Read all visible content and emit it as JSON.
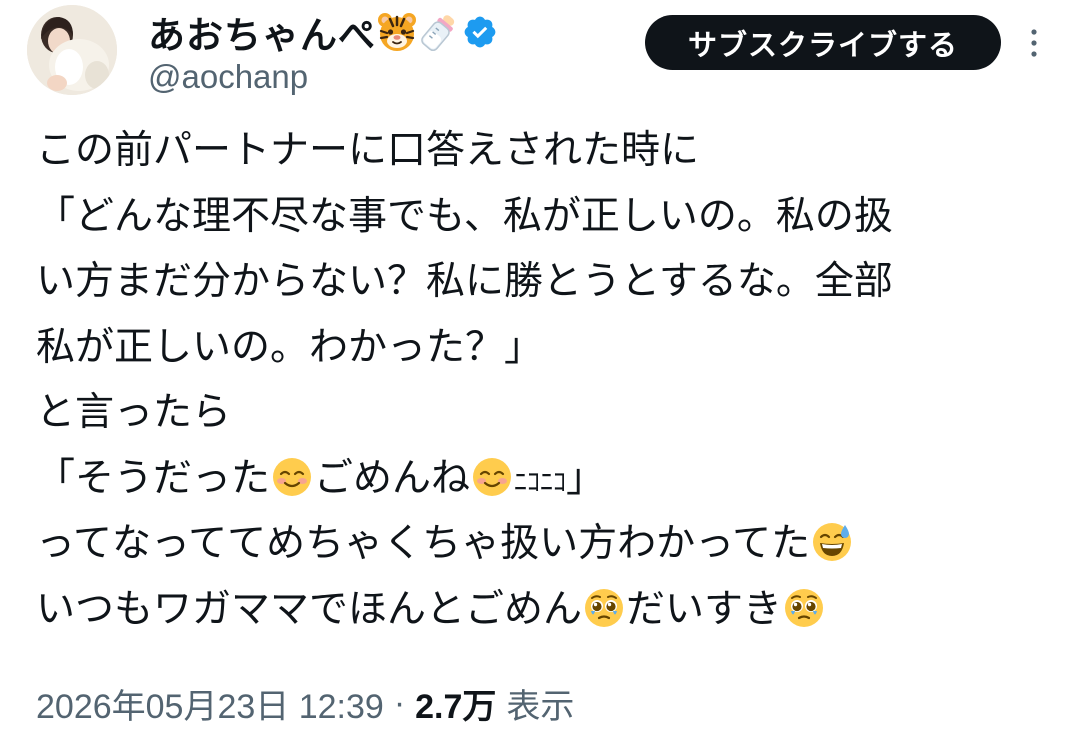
{
  "author": {
    "display_name": "あおちゃんぺ",
    "name_emojis": [
      "tiger-face-icon",
      "baby-bottle-icon"
    ],
    "verified": true,
    "handle": "@aochanp"
  },
  "actions": {
    "subscribe_label": "サブスクライブする",
    "more_icon": "more-vertical-icon"
  },
  "tweet": {
    "lines": [
      {
        "segments": [
          {
            "t": "この前パートナーに口答えされた時に"
          }
        ]
      },
      {
        "segments": [
          {
            "t": "「どんな理不尽な事でも、私が正しいの。私の扱"
          }
        ]
      },
      {
        "segments": [
          {
            "t": "い方まだ分からない？私に勝とうとするな。全部"
          }
        ]
      },
      {
        "segments": [
          {
            "t": "私が正しいの。わかった？」"
          }
        ]
      },
      {
        "segments": [
          {
            "t": "と言ったら"
          }
        ]
      },
      {
        "segments": [
          {
            "t": "「そうだった"
          },
          {
            "emoji": "smiling-face-icon"
          },
          {
            "t": "ごめんね"
          },
          {
            "emoji": "smiling-face-icon"
          },
          {
            "t": "ﾆｺﾆｺ",
            "small": true
          },
          {
            "t": "」"
          }
        ]
      },
      {
        "segments": [
          {
            "t": "ってなっててめちゃくちゃ扱い方わかってた"
          },
          {
            "emoji": "grinning-sweat-icon"
          }
        ]
      },
      {
        "segments": [
          {
            "t": "いつもワガママでほんとごめん"
          },
          {
            "emoji": "pleading-face-icon"
          },
          {
            "t": "だいすき"
          },
          {
            "emoji": "pleading-face-icon"
          }
        ]
      }
    ]
  },
  "meta": {
    "datetime": "2026年05月23日 12:39",
    "separator": "·",
    "views_count": "2.7万",
    "views_label": "表示"
  },
  "colors": {
    "text": "#0f1419",
    "secondary": "#536471",
    "verified": "#1d9bf0",
    "button_bg": "#0f1419",
    "button_text": "#ffffff"
  }
}
